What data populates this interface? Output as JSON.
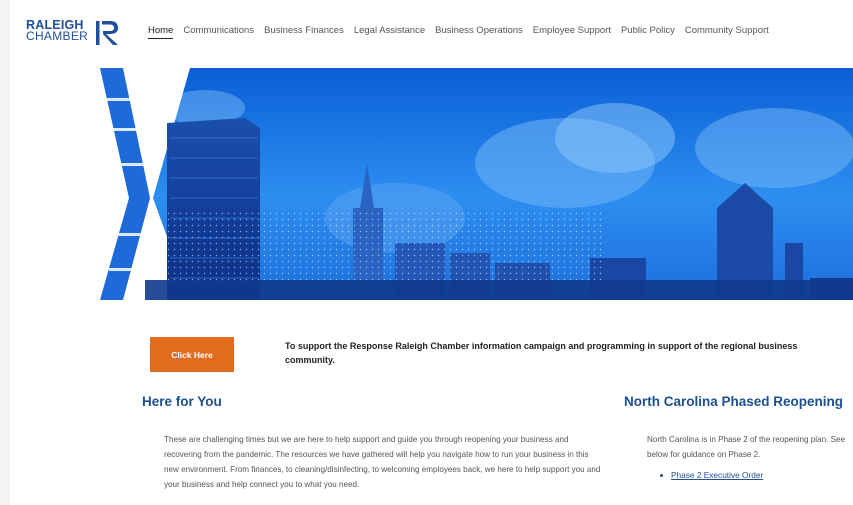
{
  "logo": {
    "line1": "RALEIGH",
    "line2": "CHAMBER"
  },
  "nav": {
    "items": [
      {
        "label": "Home",
        "active": true
      },
      {
        "label": "Communications"
      },
      {
        "label": "Business Finances"
      },
      {
        "label": "Legal Assistance"
      },
      {
        "label": "Business Operations"
      },
      {
        "label": "Employee Support"
      },
      {
        "label": "Public Policy"
      },
      {
        "label": "Community Support"
      }
    ]
  },
  "cta": {
    "button_label": "Click Here",
    "text": "To support the Response Raleigh Chamber information campaign and programming in support of the regional business community."
  },
  "here_for_you": {
    "heading": "Here for You",
    "body": "These are challenging times but we are here to help support and guide you through reopening your business and recovering from the pandemic. The resources we have gathered will help you navigate how to run your business in this new environment. From finances, to cleaning/disinfecting, to welcoming employees back, we here to help support you and your business and help connect you to what you need."
  },
  "reopening": {
    "heading": "North Carolina Phased Reopening",
    "body": "North Carolina is in Phase 2 of the reopening plan. See below for guidance on Phase 2.",
    "links": [
      "Phase 2 Executive Order"
    ]
  },
  "colors": {
    "brand_blue": "#1d4f91",
    "cta_orange": "#e36b1c",
    "hero_blue": "#1a73d9"
  }
}
